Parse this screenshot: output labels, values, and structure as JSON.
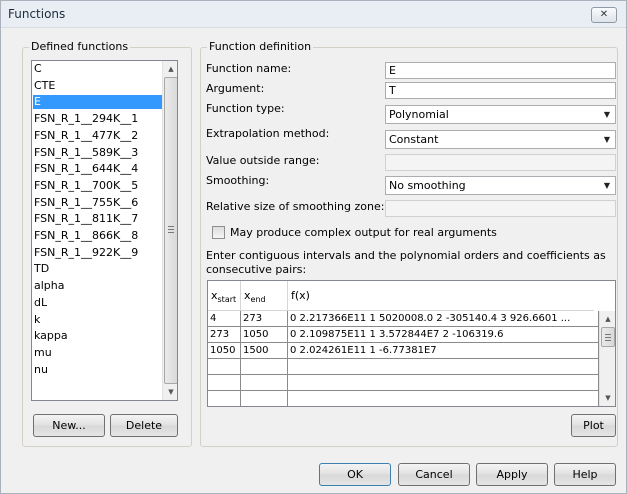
{
  "window": {
    "title": "Functions",
    "close_glyph": "✕"
  },
  "defined": {
    "label": "Defined functions",
    "items": [
      "C",
      "CTE",
      "E",
      "FSN_R_1__294K__1",
      "FSN_R_1__477K__2",
      "FSN_R_1__589K__3",
      "FSN_R_1__644K__4",
      "FSN_R_1__700K__5",
      "FSN_R_1__755K__6",
      "FSN_R_1__811K__7",
      "FSN_R_1__866K__8",
      "FSN_R_1__922K__9",
      "TD",
      "alpha",
      "dL",
      "k",
      "kappa",
      "mu",
      "nu"
    ],
    "selected_index": 2,
    "new_label": "New...",
    "delete_label": "Delete"
  },
  "definition": {
    "label": "Function definition",
    "name_label": "Function name:",
    "name_value": "E",
    "argument_label": "Argument:",
    "argument_value": "T",
    "type_label": "Function type:",
    "type_value": "Polynomial",
    "extrap_label": "Extrapolation method:",
    "extrap_value": "Constant",
    "outside_label": "Value outside range:",
    "outside_value": "",
    "smoothing_label": "Smoothing:",
    "smoothing_value": "No smoothing",
    "relsize_label": "Relative size of smoothing zone:",
    "relsize_value": "",
    "complex_label": "May produce complex output for real arguments",
    "complex_checked": false,
    "instructions": "Enter contiguous intervals and the polynomial orders and coefficients as consecutive pairs:",
    "table": {
      "col_start": "x",
      "col_start_sub": "start",
      "col_end": "x",
      "col_end_sub": "end",
      "col_f": "f(x)",
      "rows": [
        {
          "start": "4",
          "end": "273",
          "f": "0 2.217366E11 1 5020008.0 2 -305140.4 3 926.6601 ..."
        },
        {
          "start": "273",
          "end": "1050",
          "f": "0 2.109875E11 1 3.572844E7 2 -106319.6"
        },
        {
          "start": "1050",
          "end": "1500",
          "f": "0 2.024261E11 1 -6.77381E7"
        },
        {
          "start": "",
          "end": "",
          "f": ""
        },
        {
          "start": "",
          "end": "",
          "f": ""
        },
        {
          "start": "",
          "end": "",
          "f": ""
        }
      ]
    },
    "plot_label": "Plot"
  },
  "footer": {
    "ok": "OK",
    "cancel": "Cancel",
    "apply": "Apply",
    "help": "Help"
  }
}
